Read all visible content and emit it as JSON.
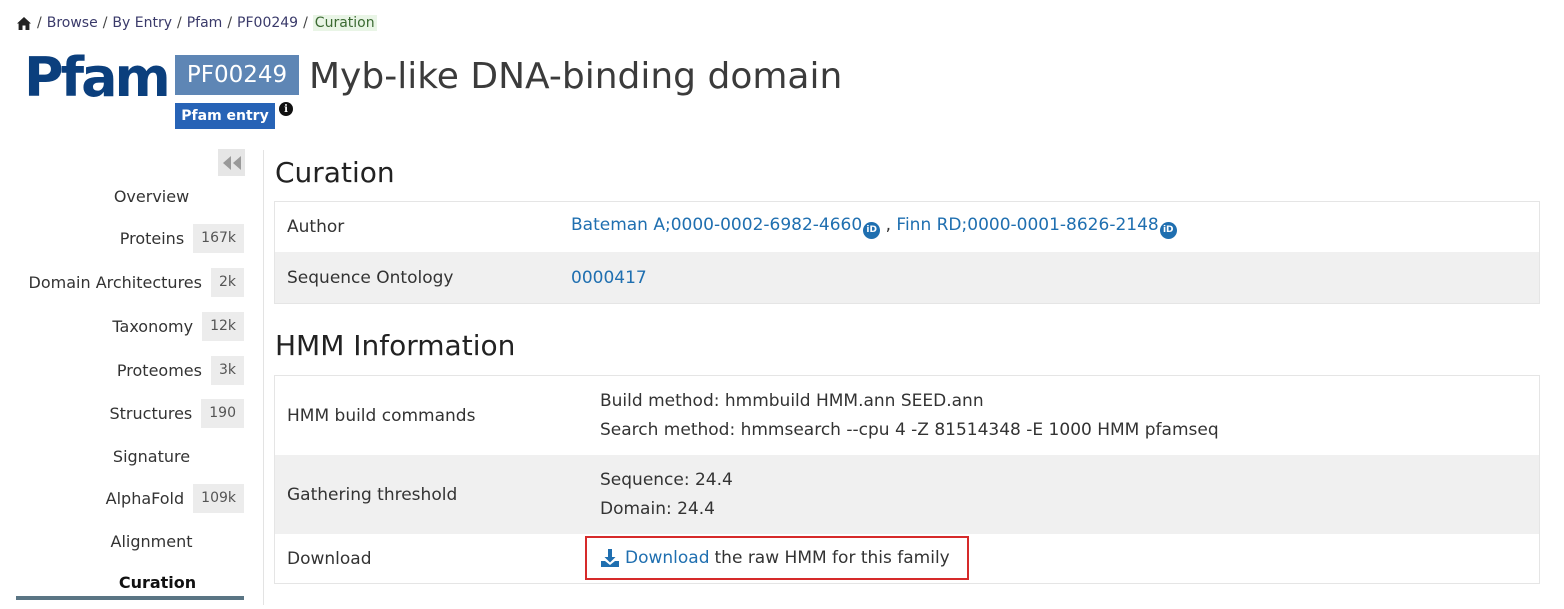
{
  "breadcrumb": {
    "items": [
      "Browse",
      "By Entry",
      "Pfam",
      "PF00249"
    ],
    "current": "Curation",
    "separator": "/"
  },
  "header": {
    "logo_text": "Pfam",
    "accession": "PF00249",
    "title": "Myb-like DNA-binding domain",
    "entry_type": "Pfam entry",
    "info_icon": "info-icon"
  },
  "sidebar": {
    "collapse_icon": "double-chevron-left-icon",
    "items": [
      {
        "label": "Overview",
        "count": ""
      },
      {
        "label": "Proteins",
        "count": "167k"
      },
      {
        "label": "Domain Architectures",
        "count": "2k"
      },
      {
        "label": "Taxonomy",
        "count": "12k"
      },
      {
        "label": "Proteomes",
        "count": "3k"
      },
      {
        "label": "Structures",
        "count": "190"
      },
      {
        "label": "Signature",
        "count": ""
      },
      {
        "label": "AlphaFold",
        "count": "109k"
      },
      {
        "label": "Alignment",
        "count": ""
      },
      {
        "label": "Curation",
        "count": ""
      }
    ],
    "active": "Curation"
  },
  "curation": {
    "heading": "Curation",
    "author_label": "Author",
    "authors": [
      {
        "name": "Bateman A;0000-0002-6982-4660",
        "icon": "orcid-icon"
      },
      {
        "name": "Finn RD;0000-0001-8626-2148",
        "icon": "orcid-icon"
      }
    ],
    "author_separator": ",",
    "so_label": "Sequence Ontology",
    "so_value": "0000417"
  },
  "hmm": {
    "heading": "HMM Information",
    "build_label": "HMM build commands",
    "build_method": "Build method: hmmbuild HMM.ann SEED.ann",
    "search_method": "Search method: hmmsearch --cpu 4 -Z 81514348 -E 1000 HMM pfamseq",
    "threshold_label": "Gathering threshold",
    "sequence": "Sequence: 24.4",
    "domain": "Domain: 24.4",
    "download_label": "Download",
    "download_link": "Download",
    "download_text": "the raw HMM for this family"
  },
  "colors": {
    "accession_badge": "#5e86b5",
    "type_badge": "#2763b6",
    "link": "#1f6fb0",
    "highlight_border": "#d62a2a",
    "active_bar": "#5a7584"
  }
}
